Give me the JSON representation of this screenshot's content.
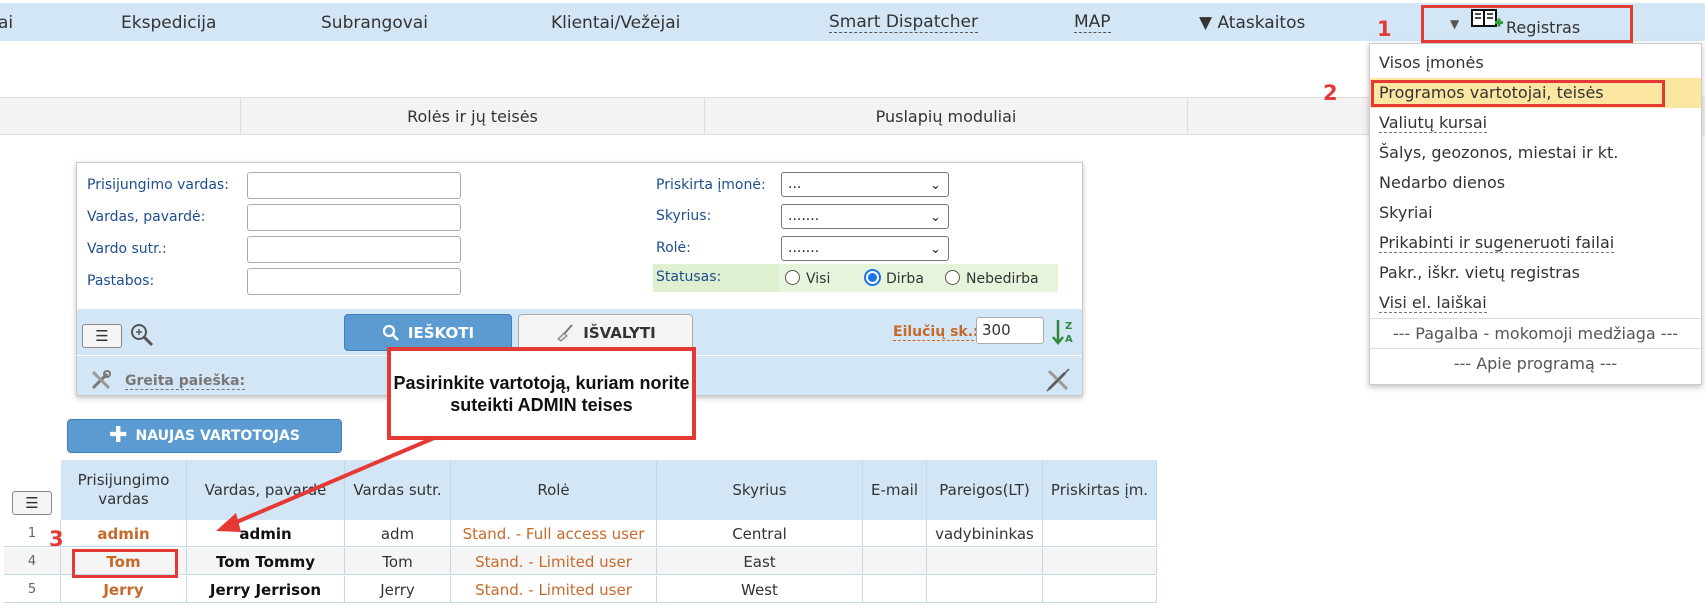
{
  "nav": {
    "items": [
      "ai",
      "Ekspedicija",
      "Subrangovai",
      "Klientai/Vežėjai",
      "Smart Dispatcher",
      "MAP",
      "▼ Ataskaitos"
    ],
    "registras": "Registras"
  },
  "tabs": [
    "Rolės ir jų teisės",
    "Puslapių moduliai"
  ],
  "search": {
    "labels": {
      "login": "Prisijungimo vardas:",
      "name": "Vardas, pavardė:",
      "abbr": "Vardo sutr.:",
      "notes": "Pastabos:",
      "company": "Priskirta įmonė:",
      "department": "Skyrius:",
      "role": "Rolė:",
      "status": "Statusas:"
    },
    "company_value": "...",
    "department_value": ".......",
    "role_value": ".......",
    "status_options": [
      "Visi",
      "Dirba",
      "Nebedirba"
    ],
    "status_selected": "Dirba",
    "search_button": "IEŠKOTI",
    "clear_button": "IŠVALYTI",
    "rows_label": "Eilučių sk.:",
    "rows_value": "300",
    "quick_search": "Greita paieška:"
  },
  "dropdown": {
    "items": [
      "Visos įmonės",
      "Programos vartotojai, teisės",
      "Valiutų kursai",
      "Šalys, geozonos, miestai ir kt.",
      "Nedarbo dienos",
      "Skyriai",
      "Prikabinti ir sugeneruoti failai",
      "Pakr., iškr. vietų registras",
      "Visi el. laiškai",
      "--- Pagalba - mokomoji medžiaga ---",
      "--- Apie programą ---"
    ]
  },
  "new_user_button": "NAUJAS VARTOTOJAS",
  "table": {
    "headers": [
      "Prisijungimo vardas",
      "Vardas, pavardė",
      "Vardas sutr.",
      "Rolė",
      "Skyrius",
      "E-mail",
      "Pareigos(LT)",
      "Priskirtas įm."
    ],
    "rows": [
      {
        "num": "1",
        "login": "admin",
        "name": "admin",
        "abbr": "adm",
        "role": "Stand. - Full access user",
        "dept": "Central",
        "email": "",
        "position": "vadybininkas",
        "company": ""
      },
      {
        "num": "4",
        "login": "Tom",
        "name": "Tom Tommy",
        "abbr": "Tom",
        "role": "Stand. - Limited user",
        "dept": "East",
        "email": "",
        "position": "",
        "company": ""
      },
      {
        "num": "5",
        "login": "Jerry",
        "name": "Jerry Jerrison",
        "abbr": "Jerry",
        "role": "Stand. - Limited user",
        "dept": "West",
        "email": "",
        "position": "",
        "company": ""
      }
    ]
  },
  "annotations": {
    "step1": "1",
    "step2": "2",
    "step3": "3",
    "callout": "Pasirinkite vartotoją, kuriam norite suteikti ADMIN teises",
    "color": "#e53935"
  }
}
